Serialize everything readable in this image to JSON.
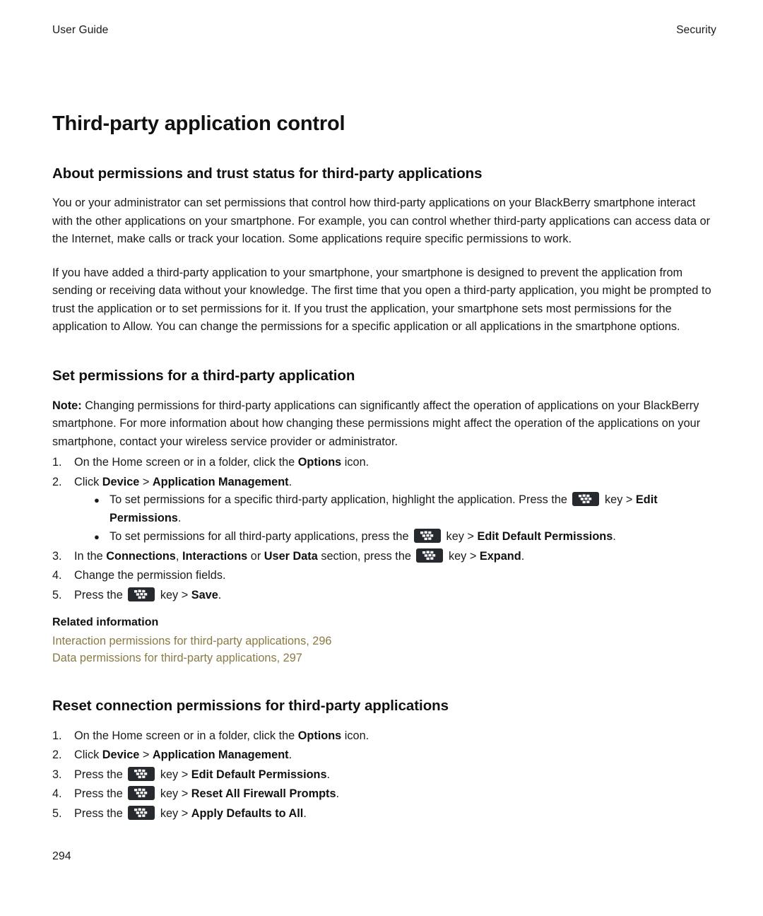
{
  "header": {
    "left": "User Guide",
    "right": "Security"
  },
  "doc": {
    "title": "Third-party application control",
    "page_number": "294"
  },
  "section1": {
    "heading": "About permissions and trust status for third-party applications",
    "paragraph1": "You or your administrator can set permissions that control how third-party applications on your BlackBerry smartphone interact with the other applications on your smartphone. For example, you can control whether third-party applications can access data or the Internet, make calls or track your location. Some applications require specific permissions to work.",
    "paragraph2": "If you have added a third-party application to your smartphone, your smartphone is designed to prevent the application from sending or receiving data without your knowledge. The first time that you open a third-party application, you might be prompted to trust the application or to set permissions for it. If you trust the application, your smartphone sets most permissions for the application to Allow. You can change the permissions for a specific application or all applications in the smartphone options."
  },
  "section2": {
    "heading": "Set permissions for a third-party application",
    "note_label": "Note:",
    "note_text": " Changing permissions for third-party applications can significantly affect the operation of applications on your BlackBerry smartphone. For more information about how changing these permissions might affect the operation of the applications on your smartphone, contact your wireless service provider or administrator.",
    "steps": {
      "n1": "1.",
      "n2": "2.",
      "n3": "3.",
      "n4": "4.",
      "n5": "5.",
      "step1_a": "On the Home screen or in a folder, click the ",
      "step1_b": "Options",
      "step1_c": " icon.",
      "step2_a": "Click ",
      "step2_b": "Device",
      "step2_c": " > ",
      "step2_d": "Application Management",
      "step2_e": ".",
      "bullet1_a": "To set permissions for a specific third-party application, highlight the application. Press the ",
      "bullet1_b": " key > ",
      "bullet1_c": "Edit Permissions",
      "bullet1_d": ".",
      "bullet2_a": "To set permissions for all third-party applications, press the ",
      "bullet2_b": " key > ",
      "bullet2_c": "Edit Default Permissions",
      "bullet2_d": ".",
      "step3_a": "In the ",
      "step3_b": "Connections",
      "step3_c": ", ",
      "step3_d": "Interactions",
      "step3_e": " or ",
      "step3_f": "User Data",
      "step3_g": " section, press the ",
      "step3_h": " key > ",
      "step3_i": "Expand",
      "step3_j": ".",
      "step4": "Change the permission fields.",
      "step5_a": "Press the ",
      "step5_b": " key > ",
      "step5_c": "Save",
      "step5_d": "."
    },
    "related": {
      "heading": "Related information",
      "link1": "Interaction permissions for third-party applications, 296",
      "link2": "Data permissions for third-party applications, 297"
    }
  },
  "section3": {
    "heading": "Reset connection permissions for third-party applications",
    "steps": {
      "n1": "1.",
      "n2": "2.",
      "n3": "3.",
      "n4": "4.",
      "n5": "5.",
      "step1_a": "On the Home screen or in a folder, click the ",
      "step1_b": "Options",
      "step1_c": " icon.",
      "step2_a": "Click ",
      "step2_b": "Device",
      "step2_c": " > ",
      "step2_d": "Application Management",
      "step2_e": ".",
      "step3_a": "Press the ",
      "step3_b": " key > ",
      "step3_c": "Edit Default Permissions",
      "step3_d": ".",
      "step4_a": "Press the ",
      "step4_b": " key > ",
      "step4_c": "Reset All Firewall Prompts",
      "step4_d": ".",
      "step5_a": "Press the ",
      "step5_b": " key > ",
      "step5_c": "Apply Defaults to All",
      "step5_d": "."
    }
  },
  "icons": {
    "menu_key": "blackberry-menu-key-icon"
  },
  "colors": {
    "text": "#1a1a1a",
    "heading": "#111111",
    "link": "#8a7a45",
    "key_icon_bg": "#26292e",
    "page_bg": "#ffffff"
  }
}
